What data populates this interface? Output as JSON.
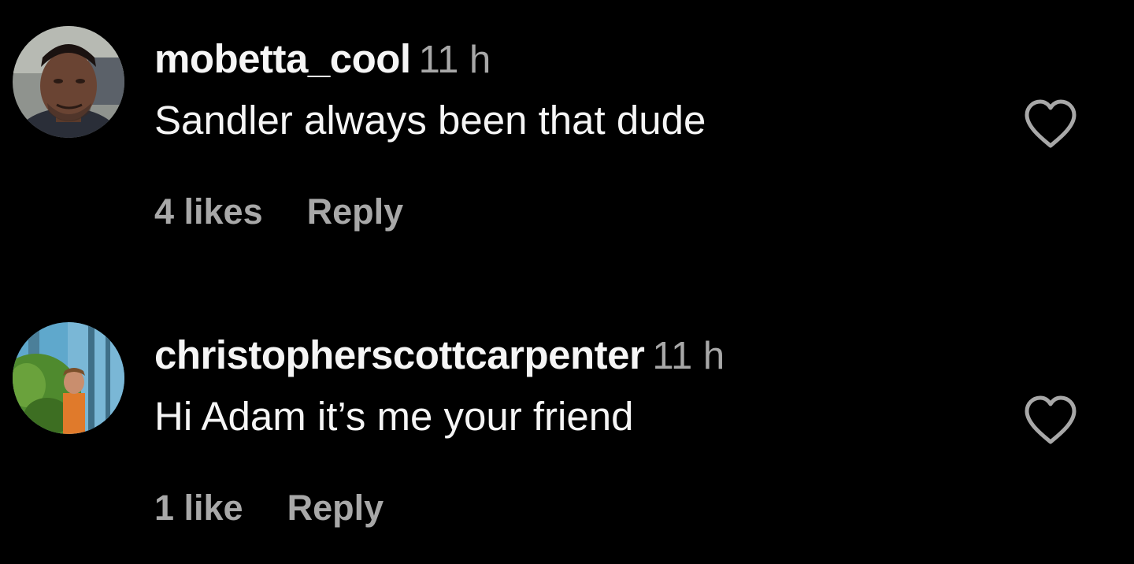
{
  "comments": [
    {
      "username": "mobetta_cool",
      "time": "11 h",
      "text": "Sandler always been that dude",
      "likes": "4 likes",
      "reply_label": "Reply",
      "avatar_icon": "profile-photo-man",
      "like_icon": "heart-outline-icon"
    },
    {
      "username": "christopherscottcarpenter",
      "time": "11 h",
      "text": "Hi Adam it’s me your friend",
      "likes": "1 like",
      "reply_label": "Reply",
      "avatar_icon": "profile-photo-outdoor",
      "like_icon": "heart-outline-icon"
    }
  ],
  "colors": {
    "background": "#000000",
    "primary_text": "#f5f5f5",
    "secondary_text": "#a8a8a8"
  }
}
